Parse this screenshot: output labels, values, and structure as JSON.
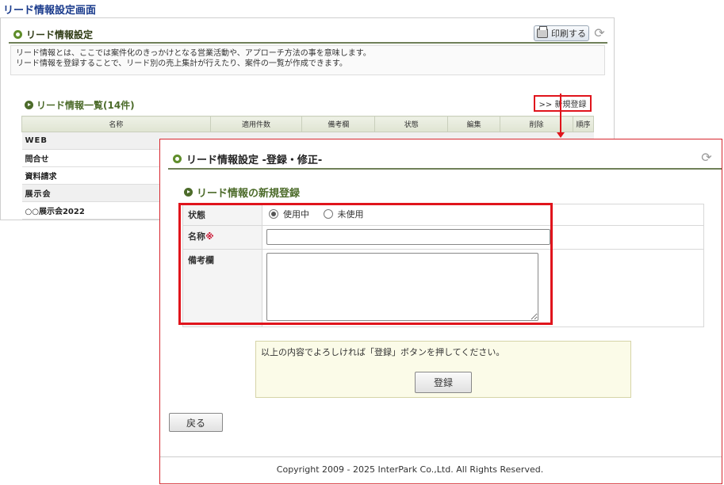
{
  "page_caption": "リード情報設定画面",
  "background": {
    "title": "リード情報設定",
    "print_label": "印刷する",
    "description": [
      "リード情報とは、ここでは案件化のきっかけとなる営業活動や、アプローチ方法の事を意味します。",
      "リード情報を登録することで、リード別の売上集計が行えたり、案件の一覧が作成できます。"
    ],
    "list_title": "リード情報一覧(14件)",
    "new_button": ">> 新規登録",
    "columns": [
      "名称",
      "適用件数",
      "備考欄",
      "状態",
      "編集",
      "削除",
      "順序"
    ],
    "rows": [
      {
        "label": "WEB",
        "category": true
      },
      {
        "label": "問合せ",
        "category": false
      },
      {
        "label": "資料請求",
        "category": false
      },
      {
        "label": "展示会",
        "category": true
      },
      {
        "label": "○○展示会2022",
        "category": false
      }
    ]
  },
  "dialog": {
    "title": "リード情報設定 -登録・修正-",
    "subtitle": "リード情報の新規登録",
    "fields": {
      "status_label": "状態",
      "status_on": "使用中",
      "status_off": "未使用",
      "name_label": "名称",
      "required_mark": "※",
      "name_value": "",
      "memo_label": "備考欄",
      "memo_value": ""
    },
    "confirm_message": "以上の内容でよろしければ「登録」ボタンを押してください。",
    "register_button": "登録",
    "back_button": "戻る",
    "copyright": "Copyright 2009 - 2025 InterPark Co.,Ltd. All Rights Reserved."
  },
  "icons": {
    "refresh": "refresh-icon",
    "printer": "printer-icon",
    "bullet": "circle-arrow-icon"
  },
  "colors": {
    "highlight": "#e0141c",
    "accent_green": "#4c6b2a",
    "caption_blue": "#1a3b8c"
  }
}
